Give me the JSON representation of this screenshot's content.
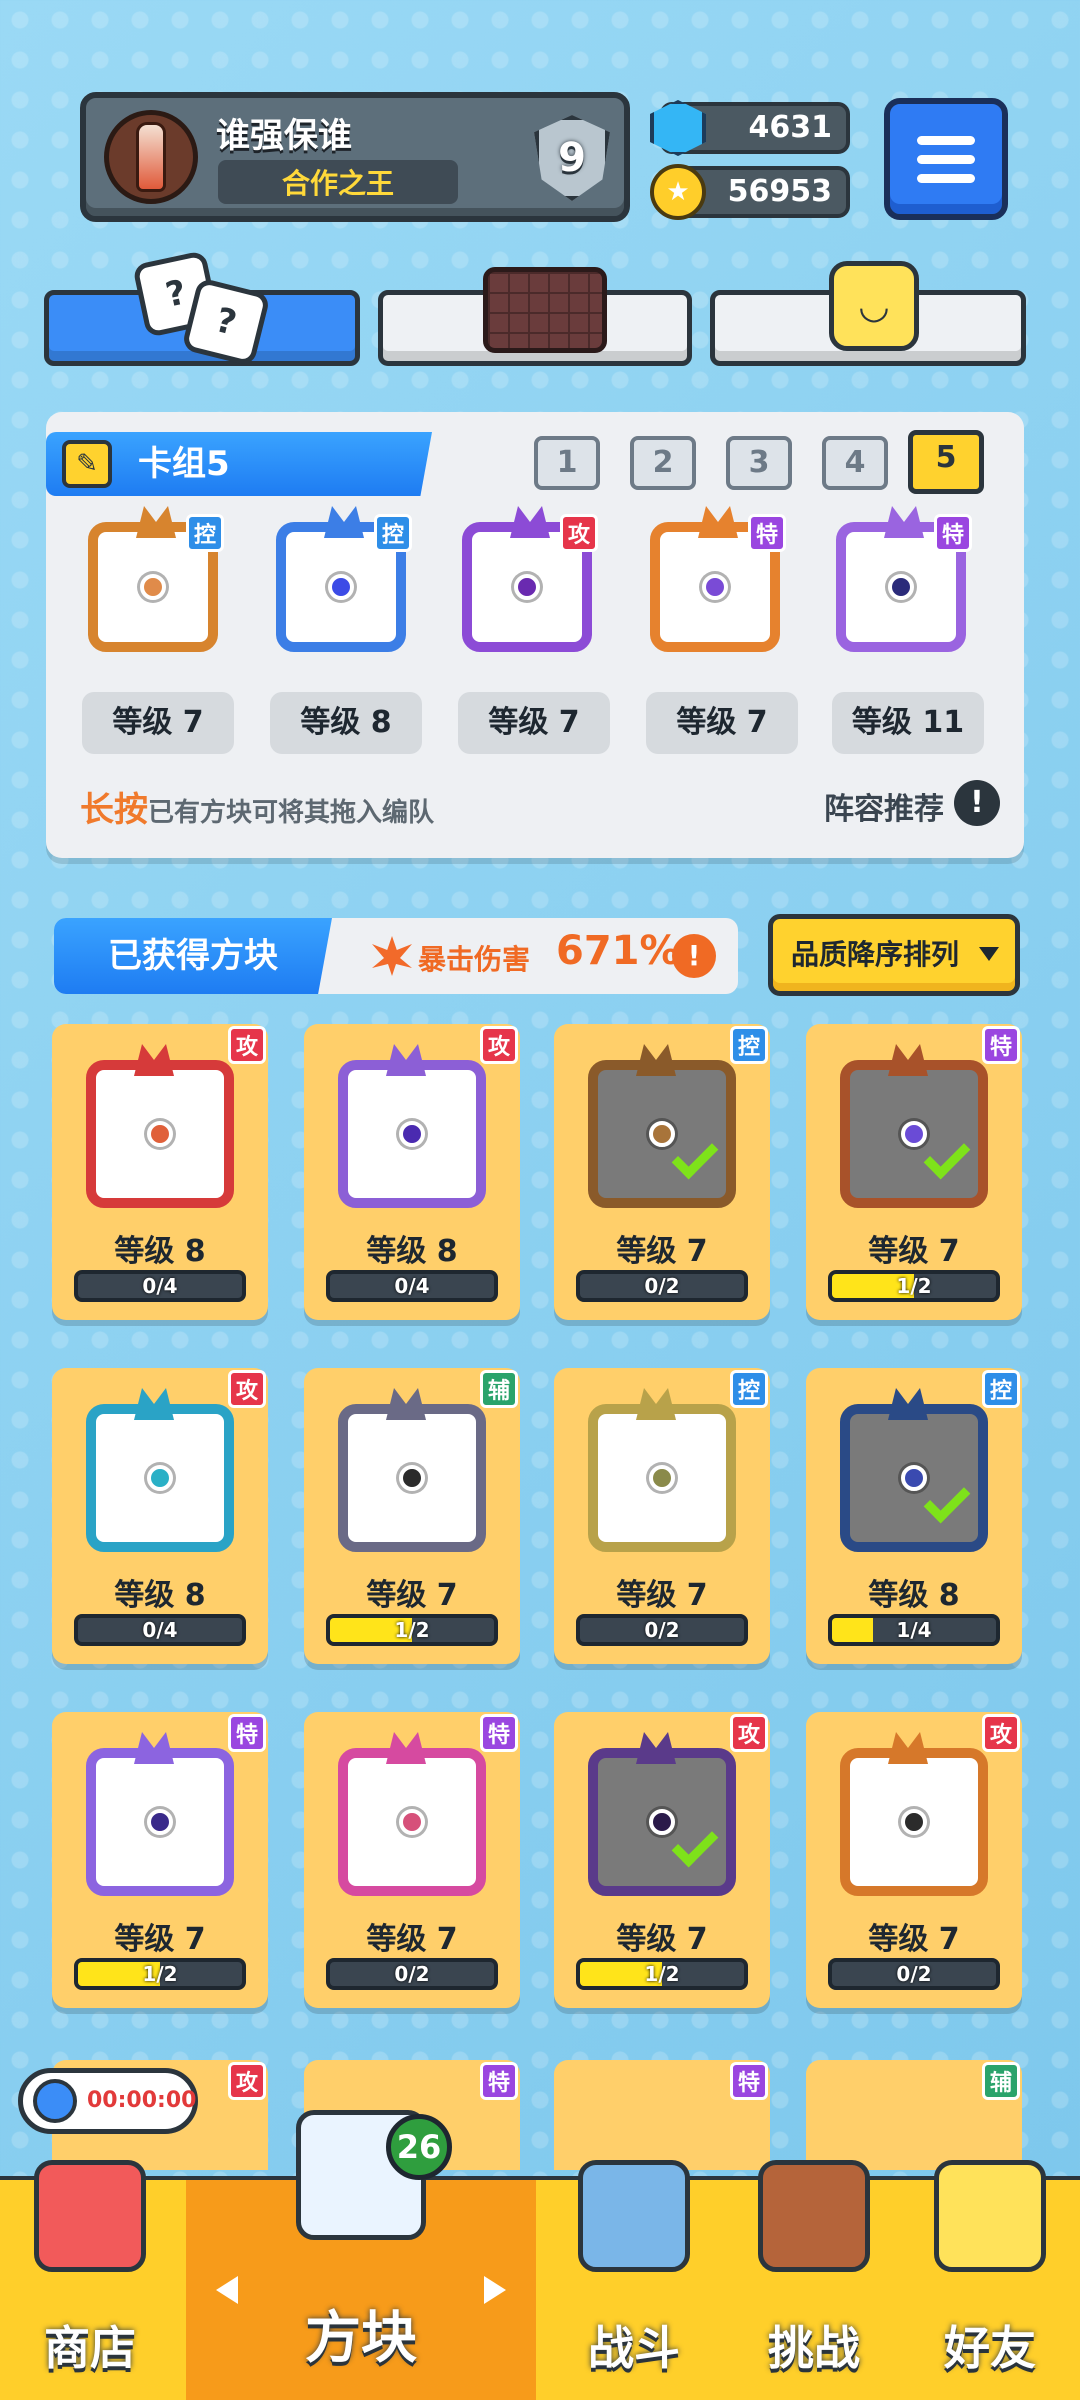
{
  "header": {
    "player_name": "谁强保谁",
    "title_badge": "合作之王",
    "rank_level": "9",
    "gems": "4631",
    "coins": "56953"
  },
  "colors": {
    "accent_blue": "#2f7bf3",
    "accent_yellow": "#ffd22e",
    "crit_orange": "#f06a24",
    "tag_control": "#2e8ee8",
    "tag_attack": "#e6354a",
    "tag_special": "#9a46e0",
    "tag_support": "#2aa36b"
  },
  "deck": {
    "label": "卡组5",
    "numbers": [
      "1",
      "2",
      "3",
      "4",
      "5"
    ],
    "selected": "5",
    "cards": [
      {
        "tag": "控",
        "level": "等级 7",
        "color": "#d7842e",
        "core": "#e08b4a"
      },
      {
        "tag": "控",
        "level": "等级 8",
        "color": "#3c7ee6",
        "core": "#3c4be6"
      },
      {
        "tag": "攻",
        "level": "等级 7",
        "color": "#8c4bd6",
        "core": "#6a2ab0"
      },
      {
        "tag": "特",
        "level": "等级 7",
        "color": "#e6822e",
        "core": "#7a4bd6"
      },
      {
        "tag": "特",
        "level": "等级 11",
        "color": "#9a64e0",
        "core": "#2b2b7a"
      }
    ],
    "hint_em": "长按",
    "hint_rest": "已有方块可将其拖入编队",
    "recommend": "阵容推荐"
  },
  "obtained": {
    "title": "已获得方块",
    "crit_label": "暴击伤害",
    "crit_value": "671%",
    "sort_label": "品质降序排列"
  },
  "owned_cards": [
    {
      "tag": "攻",
      "level": "等级 8",
      "progress": "0/4",
      "fill": 0,
      "color": "#d63a3a",
      "core": "#e0603a",
      "checked": false,
      "dim": false
    },
    {
      "tag": "攻",
      "level": "等级 8",
      "progress": "0/4",
      "fill": 0,
      "color": "#8c5fd6",
      "core": "#4a2ab0",
      "checked": false,
      "dim": false
    },
    {
      "tag": "控",
      "level": "等级 7",
      "progress": "0/2",
      "fill": 0,
      "color": "#8a5a2a",
      "core": "#a8743a",
      "checked": true,
      "dim": true
    },
    {
      "tag": "特",
      "level": "等级 7",
      "progress": "1/2",
      "fill": 0.5,
      "color": "#a8522a",
      "core": "#6a4bd6",
      "checked": true,
      "dim": true
    },
    {
      "tag": "攻",
      "level": "等级 8",
      "progress": "0/4",
      "fill": 0,
      "color": "#2aa3c6",
      "core": "#2ab0c6",
      "checked": false,
      "dim": false
    },
    {
      "tag": "辅",
      "level": "等级 7",
      "progress": "1/2",
      "fill": 0.5,
      "color": "#6a6a86",
      "core": "#2b2b2b",
      "checked": false,
      "dim": false
    },
    {
      "tag": "控",
      "level": "等级 7",
      "progress": "0/2",
      "fill": 0,
      "color": "#b8a24a",
      "core": "#8a8a4a",
      "checked": false,
      "dim": false
    },
    {
      "tag": "控",
      "level": "等级 8",
      "progress": "1/4",
      "fill": 0.25,
      "color": "#2a4a86",
      "core": "#3a4ab0",
      "checked": true,
      "dim": true
    },
    {
      "tag": "特",
      "level": "等级 7",
      "progress": "1/2",
      "fill": 0.5,
      "color": "#8c64e0",
      "core": "#3a2a8a",
      "checked": false,
      "dim": false
    },
    {
      "tag": "特",
      "level": "等级 7",
      "progress": "0/2",
      "fill": 0,
      "color": "#d64aa0",
      "core": "#d6507a",
      "checked": false,
      "dim": false
    },
    {
      "tag": "攻",
      "level": "等级 7",
      "progress": "1/2",
      "fill": 0.5,
      "color": "#5a3a8a",
      "core": "#2a1a4a",
      "checked": true,
      "dim": true
    },
    {
      "tag": "攻",
      "level": "等级 7",
      "progress": "0/2",
      "fill": 0,
      "color": "#d6782a",
      "core": "#2b2b2b",
      "checked": false,
      "dim": false
    }
  ],
  "partial_tags": [
    "攻",
    "特",
    "特",
    "辅"
  ],
  "timer": "00:00:00",
  "nav": {
    "items": [
      "商店",
      "方块",
      "战斗",
      "挑战",
      "好友"
    ],
    "active": "方块",
    "badge": "26"
  }
}
